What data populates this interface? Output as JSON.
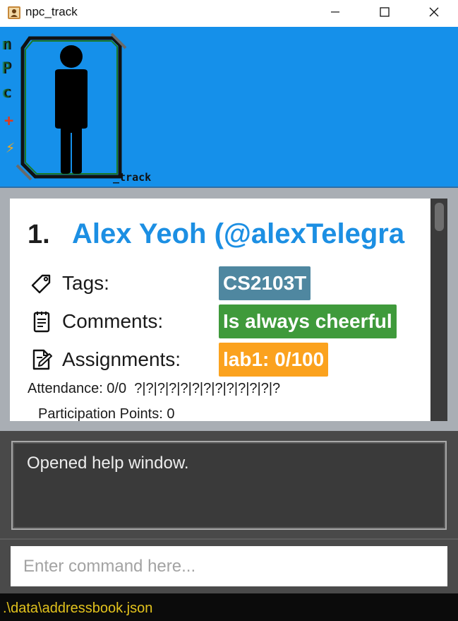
{
  "window": {
    "title": "npc_track",
    "icon": "contact-book-icon"
  },
  "banner": {
    "logo_letters": [
      "n",
      "P",
      "c",
      "+",
      "⚡"
    ],
    "logo_suffix": "_track",
    "color": "#1590ea"
  },
  "person_list": [
    {
      "index": "1.",
      "name": "Alex Yeoh (@alexTelegra",
      "fields": [
        {
          "icon": "tag-icon",
          "label": "Tags:",
          "value": "CS2103T",
          "color": "#4f87a0"
        },
        {
          "icon": "notepad-icon",
          "label": "Comments:",
          "value": "Is always cheerful",
          "color": "#3f9a3b"
        },
        {
          "icon": "edit-document-icon",
          "label": "Assignments:",
          "value": "lab1: 0/100",
          "color": "#fba21e"
        }
      ],
      "attendance": "Attendance: 0/0  ?|?|?|?|?|?|?|?|?|?|?|?|?",
      "participation": "Participation Points: 0"
    }
  ],
  "result": {
    "message": "Opened help window."
  },
  "command": {
    "placeholder": "Enter command here...",
    "value": ""
  },
  "status_bar": {
    "path": ".\\data\\addressbook.json"
  }
}
